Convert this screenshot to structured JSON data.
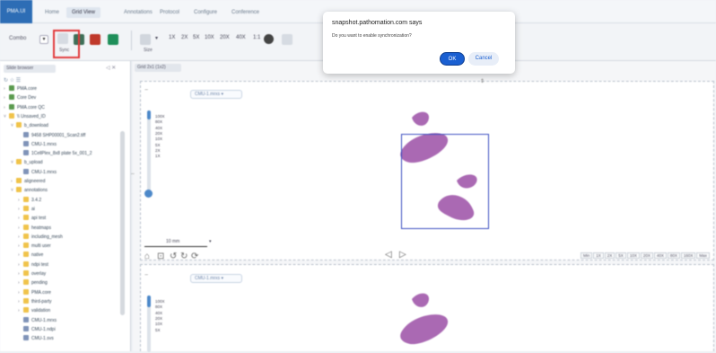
{
  "menubar": {
    "brand": "PMA.UI",
    "items": [
      "Home",
      "Grid View",
      "Annotations",
      "Protocol",
      "Configure",
      "Conference"
    ],
    "active_index": 1
  },
  "toolbar": {
    "combo_label": "Combo",
    "sync_caption": "Sync",
    "size_caption": "Size",
    "zoom_steps": [
      "1X",
      "2X",
      "5X",
      "10X",
      "20X",
      "40X",
      "1:1"
    ]
  },
  "left_panel": {
    "tab": "Slide browser",
    "tools": "↻ ☆ ☰",
    "tree": [
      {
        "indent": 0,
        "icon": "check",
        "caret": "›",
        "label": "PMA.core"
      },
      {
        "indent": 0,
        "icon": "check",
        "caret": "›",
        "label": "Core Dev"
      },
      {
        "indent": 0,
        "icon": "check",
        "caret": "›",
        "label": "PMA.core QC"
      },
      {
        "indent": 0,
        "icon": "folder",
        "caret": "˅",
        "label": "\\\\ Unsaved_ID"
      },
      {
        "indent": 1,
        "icon": "folder",
        "caret": "˅",
        "label": "b_download"
      },
      {
        "indent": 2,
        "icon": "file",
        "caret": "",
        "label": "9458 SHP00001_Scan2.tiff"
      },
      {
        "indent": 2,
        "icon": "file",
        "caret": "",
        "label": "CMU-1.mrxs"
      },
      {
        "indent": 2,
        "icon": "file",
        "caret": "",
        "label": "1CellPlex_8x8 plate 5x_001_2"
      },
      {
        "indent": 1,
        "icon": "folder",
        "caret": "˅",
        "label": "b_upload"
      },
      {
        "indent": 2,
        "icon": "file",
        "caret": "",
        "label": "CMU-1.mrxs"
      },
      {
        "indent": 1,
        "icon": "folder",
        "caret": "›",
        "label": "aligneered"
      },
      {
        "indent": 1,
        "icon": "folder",
        "caret": "˅",
        "label": "annotations"
      },
      {
        "indent": 2,
        "icon": "folder",
        "caret": "›",
        "label": "3.4.2"
      },
      {
        "indent": 2,
        "icon": "folder",
        "caret": "›",
        "label": "ai"
      },
      {
        "indent": 2,
        "icon": "folder",
        "caret": "›",
        "label": "api test"
      },
      {
        "indent": 2,
        "icon": "folder",
        "caret": "›",
        "label": "heatmaps"
      },
      {
        "indent": 2,
        "icon": "folder",
        "caret": "›",
        "label": "including_mesh"
      },
      {
        "indent": 2,
        "icon": "folder",
        "caret": "›",
        "label": "multi user"
      },
      {
        "indent": 2,
        "icon": "folder",
        "caret": "›",
        "label": "native"
      },
      {
        "indent": 2,
        "icon": "folder",
        "caret": "›",
        "label": "ndpi test"
      },
      {
        "indent": 2,
        "icon": "folder",
        "caret": "›",
        "label": "overlay"
      },
      {
        "indent": 2,
        "icon": "folder",
        "caret": "›",
        "label": "pending"
      },
      {
        "indent": 2,
        "icon": "folder",
        "caret": "›",
        "label": "PMA.core"
      },
      {
        "indent": 2,
        "icon": "folder",
        "caret": "›",
        "label": "third-party"
      },
      {
        "indent": 2,
        "icon": "folder",
        "caret": "›",
        "label": "validation"
      },
      {
        "indent": 2,
        "icon": "file",
        "caret": "",
        "label": "CMU-1.mrxs"
      },
      {
        "indent": 2,
        "icon": "file",
        "caret": "",
        "label": "CMU-1.ndpi"
      },
      {
        "indent": 2,
        "icon": "file",
        "caret": "",
        "label": "CMU-1.svs"
      }
    ]
  },
  "viewer": {
    "doc_tab": "Grid 2x1 (1x2)",
    "slide_select_1": "CMU-1.mrxs",
    "slide_select_2": "CMU-1.mrxs",
    "zoom_labels": [
      "100X",
      "80X",
      "40X",
      "20X",
      "10X",
      "5X",
      "2X",
      "1X"
    ],
    "zoom_labels_2": [
      "100X",
      "80X",
      "40X",
      "20X",
      "10X",
      "5X"
    ],
    "zoom_level": 0.1,
    "scalebar": "10 mm",
    "tag_row": [
      "Min",
      "1X",
      "2X",
      "5X",
      "10X",
      "20X",
      "40X",
      "80X",
      "160X",
      "Max"
    ]
  },
  "dialog": {
    "title": "snapshot.pathomation.com says",
    "message": "Do you want to enable synchronization?",
    "ok": "OK",
    "cancel": "Cancel"
  },
  "colors": {
    "brand": "#2d6db5",
    "tissue": "#9b4fa6",
    "roi": "#3b4fc1",
    "highlight": "#e23a3a",
    "ok_button": "#1a5fd1"
  }
}
